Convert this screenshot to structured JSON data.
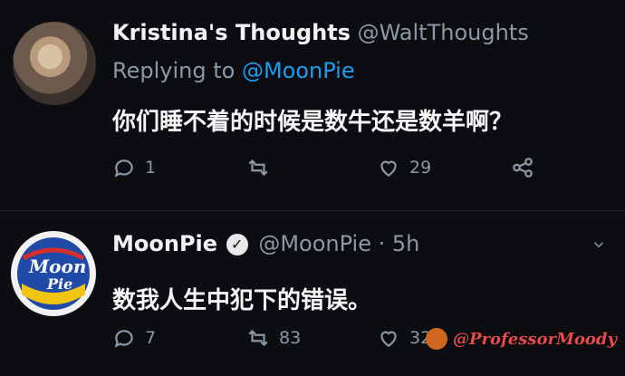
{
  "tweet1": {
    "display_name": "Kristina's Thoughts",
    "handle": "@WaltThoughts",
    "reply_prefix": "Replying to",
    "reply_to": "@MoonPie",
    "text": "你们睡不着的时候是数牛还是数羊啊？",
    "reply_count": "1",
    "retweet_count": "",
    "like_count": "29"
  },
  "tweet2": {
    "display_name": "MoonPie",
    "handle": "@MoonPie · 5h",
    "text": "数我人生中犯下的错误。",
    "reply_count": "7",
    "retweet_count": "83",
    "like_count": "322"
  },
  "avatar2_text": {
    "line1": "Moon",
    "line2": "Pie"
  },
  "watermark": "@ProfessorMoody",
  "icons": {
    "reply": "reply-icon",
    "retweet": "retweet-icon",
    "like": "heart-icon",
    "share": "share-icon",
    "verified": "verified-badge-icon",
    "more": "chevron-down-icon"
  }
}
